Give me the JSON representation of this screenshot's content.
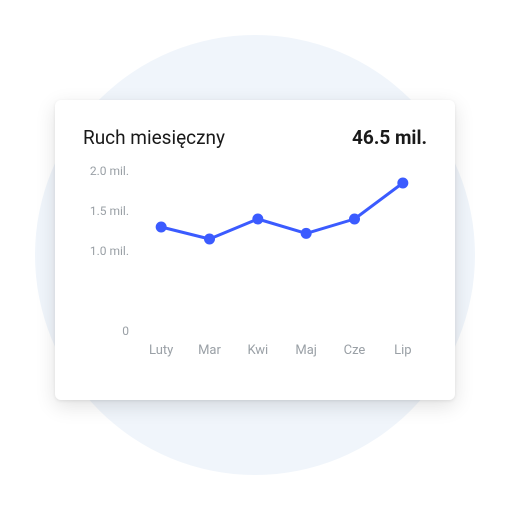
{
  "header": {
    "title": "Ruch miesięczny",
    "total": "46.5 mil."
  },
  "chart_data": {
    "type": "line",
    "categories": [
      "Luty",
      "Mar",
      "Kwi",
      "Maj",
      "Cze",
      "Lip"
    ],
    "values": [
      1.3,
      1.15,
      1.4,
      1.22,
      1.4,
      1.85
    ],
    "title": "Ruch miesięczny",
    "xlabel": "",
    "ylabel": "",
    "ylim": [
      0,
      2.0
    ],
    "y_ticks": [
      0,
      1.0,
      1.5,
      2.0
    ],
    "y_tick_labels": [
      "0",
      "1.0 mil.",
      "1.5 mil.",
      "2.0 mil."
    ]
  }
}
